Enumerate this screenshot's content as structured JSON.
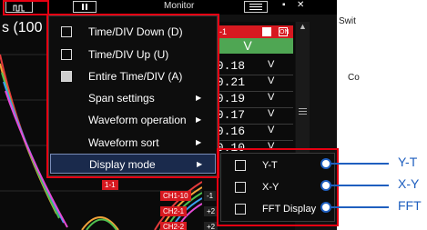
{
  "status": {
    "time_div_text": "s (100"
  },
  "toolbar": {
    "wave_icon": "waveform-icon",
    "monitor_label": "Monitor",
    "menu_icon": "hamburger-menu-icon",
    "minimize": "▪",
    "close": "✕"
  },
  "side": {
    "switch_label": "Swit",
    "co_label": "Co"
  },
  "channel_panel": {
    "header": "1-1",
    "header_badge": "ON",
    "unit_label": "V",
    "values": [
      {
        "num": ".0.18",
        "unit": "V"
      },
      {
        "num": ".0.21",
        "unit": "V"
      },
      {
        "num": ".0.19",
        "unit": "V"
      },
      {
        "num": ".0.17",
        "unit": "V"
      },
      {
        "num": ".0.16",
        "unit": "V"
      },
      {
        "num": ".0.10",
        "unit": "V"
      }
    ]
  },
  "channel_tags": {
    "tag1": "1-1",
    "tag2": "CH1-10",
    "tag3": "CH2-1",
    "tag4": "CH2-2",
    "tag2_val": "-1",
    "tag3_val": "+2",
    "tag4_val": "+2"
  },
  "context_menu": {
    "items": [
      {
        "label": "Time/DIV Down (D)",
        "icon": "time-div-down-icon"
      },
      {
        "label": "Time/DIV Up (U)",
        "icon": "time-div-up-icon"
      },
      {
        "label": "Entire Time/DIV (A)",
        "icon": "entire-time-div-icon"
      },
      {
        "label": "Span settings",
        "arrow": "▶"
      },
      {
        "label": "Waveform operation",
        "arrow": "▶"
      },
      {
        "label": "Waveform sort",
        "arrow": "▶"
      },
      {
        "label": "Display mode",
        "arrow": "▶"
      }
    ]
  },
  "display_mode_submenu": {
    "items": [
      {
        "label": "Y-T",
        "icon": "y-t-icon"
      },
      {
        "label": "X-Y",
        "icon": "x-y-icon"
      },
      {
        "label": "FFT Display",
        "icon": "fft-icon"
      }
    ]
  },
  "callouts": [
    {
      "label": "Y-T"
    },
    {
      "label": "X-Y"
    },
    {
      "label": "FFT"
    }
  ],
  "colors": {
    "highlight": "#e60012",
    "callout": "#1f5fbf",
    "channel_red": "#d71920",
    "channel_green": "#4fa653"
  }
}
